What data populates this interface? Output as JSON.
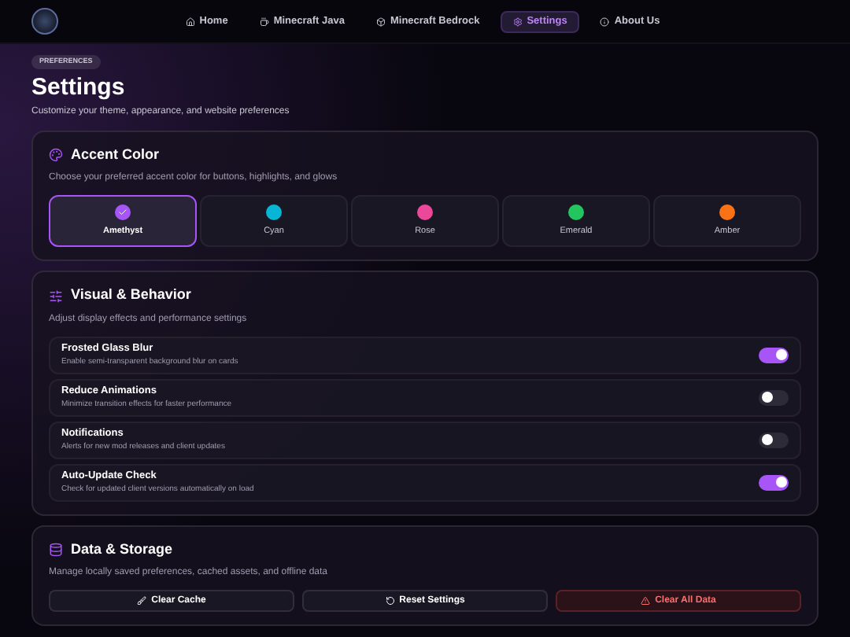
{
  "nav": {
    "items": [
      {
        "label": "Home",
        "selected": false
      },
      {
        "label": "Minecraft Java",
        "selected": false
      },
      {
        "label": "Minecraft Bedrock",
        "selected": false
      },
      {
        "label": "Settings",
        "selected": true
      },
      {
        "label": "About Us",
        "selected": false
      }
    ]
  },
  "header": {
    "badge": "PREFERENCES",
    "title": "Settings",
    "subtitle": "Customize your theme, appearance, and website preferences"
  },
  "accent": {
    "title": "Accent Color",
    "description": "Choose your preferred accent color for buttons, highlights, and glows",
    "options": [
      {
        "label": "Amethyst",
        "color": "#a855f7",
        "selected": true
      },
      {
        "label": "Cyan",
        "color": "#06b6d4",
        "selected": false
      },
      {
        "label": "Rose",
        "color": "#ec4899",
        "selected": false
      },
      {
        "label": "Emerald",
        "color": "#22c55e",
        "selected": false
      },
      {
        "label": "Amber",
        "color": "#f97316",
        "selected": false
      }
    ]
  },
  "visual": {
    "title": "Visual & Behavior",
    "description": "Adjust display effects and performance settings",
    "toggles": [
      {
        "label": "Frosted Glass Blur",
        "description": "Enable semi-transparent background blur on cards",
        "on": true
      },
      {
        "label": "Reduce Animations",
        "description": "Minimize transition effects for faster performance",
        "on": false
      },
      {
        "label": "Notifications",
        "description": "Alerts for new mod releases and client updates",
        "on": false
      },
      {
        "label": "Auto-Update Check",
        "description": "Check for updated client versions automatically on load",
        "on": true
      }
    ]
  },
  "storage": {
    "title": "Data & Storage",
    "description": "Manage locally saved preferences, cached assets, and offline data",
    "buttons": [
      {
        "label": "Clear Cache",
        "kind": "normal"
      },
      {
        "label": "Reset Settings",
        "kind": "normal"
      },
      {
        "label": "Clear All Data",
        "kind": "danger"
      }
    ]
  }
}
